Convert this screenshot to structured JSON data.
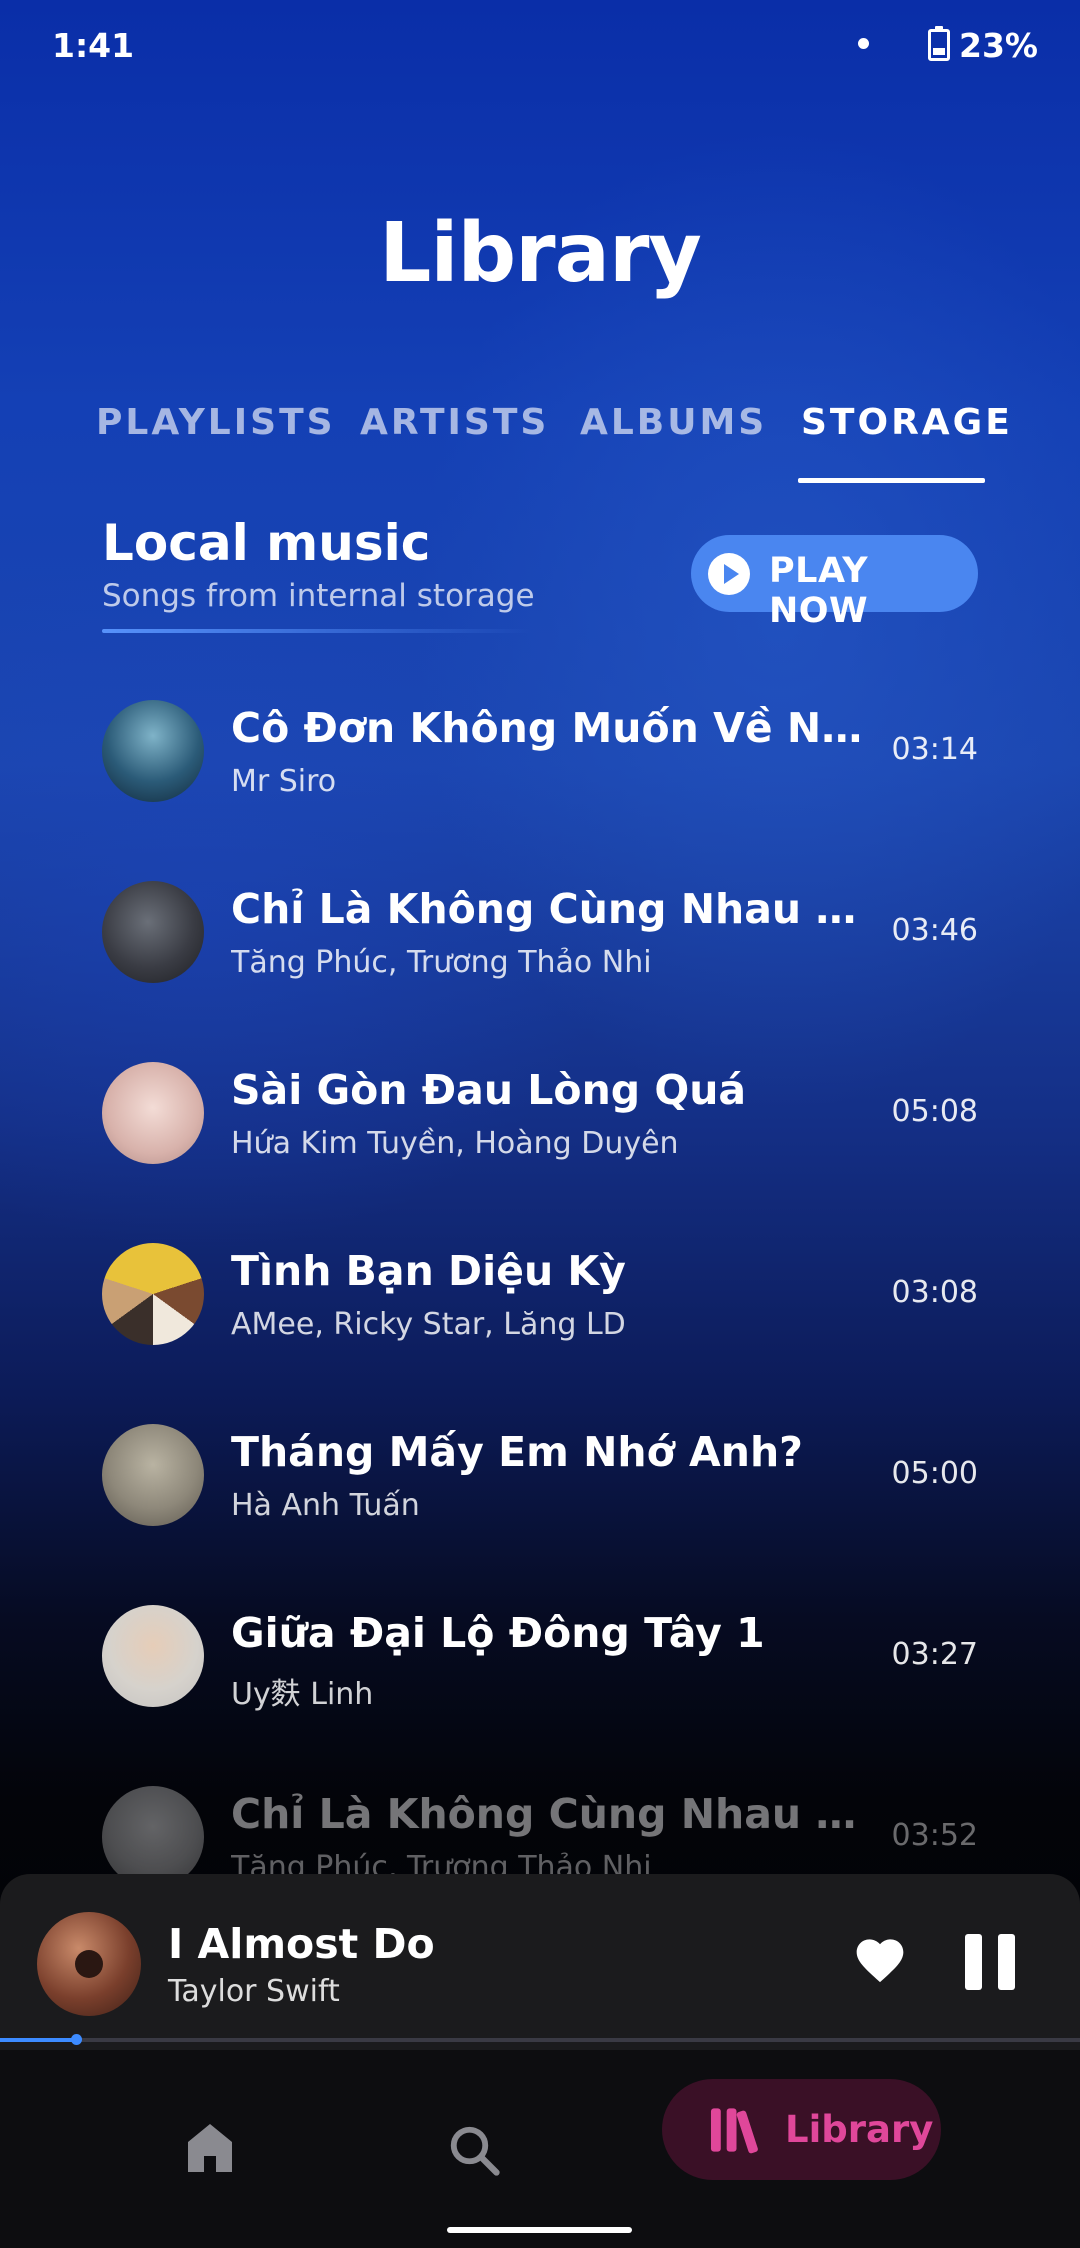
{
  "status_bar": {
    "time": "1:41",
    "battery": "23%"
  },
  "header": {
    "title": "Library"
  },
  "tabs": [
    {
      "label": "PLAYLISTS",
      "active": false
    },
    {
      "label": "ARTISTS",
      "active": false
    },
    {
      "label": "ALBUMS",
      "active": false
    },
    {
      "label": "STORAGE",
      "active": true
    }
  ],
  "section": {
    "title": "Local music",
    "subtitle": "Songs from internal storage",
    "play_label": "PLAY NOW"
  },
  "songs": [
    {
      "title": "Cô Đơn Không Muốn Về Nhà",
      "artist": "Mr Siro",
      "duration": "03:14"
    },
    {
      "title": "Chỉ Là Không Cùng Nhau (Live V...",
      "artist": "Tăng Phúc,  Trương Thảo Nhi",
      "duration": "03:46"
    },
    {
      "title": "Sài Gòn Đau Lòng Quá",
      "artist": "Hứa Kim Tuyền, Hoàng Duyên",
      "duration": "05:08"
    },
    {
      "title": "Tình Bạn Diệu Kỳ",
      "artist": "AMee, Ricky Star, Lăng LD",
      "duration": "03:08"
    },
    {
      "title": "Tháng Mấy Em Nhớ Anh?",
      "artist": "Hà Anh Tuấn",
      "duration": "05:00"
    },
    {
      "title": "Giữa Đại Lộ Đông Tây 1",
      "artist": "Uy麩 Linh",
      "duration": "03:27"
    },
    {
      "title": "Chỉ Là Không Cùng Nhau (Live)",
      "artist": "Tăng Phúc, Trương Thảo Nhi",
      "duration": "03:52"
    }
  ],
  "now_playing": {
    "title": "I Almost Do",
    "artist": "Taylor Swift",
    "progress": 0.07
  },
  "bottom_nav": {
    "items": [
      {
        "icon": "home-icon",
        "label": ""
      },
      {
        "icon": "search-icon",
        "label": ""
      },
      {
        "icon": "library-icon",
        "label": "Library",
        "active": true
      }
    ]
  },
  "colors": {
    "accent_blue": "#4a86f0",
    "progress_blue": "#3d8bff",
    "library_pink": "#e0479a",
    "library_pill_bg": "#3a1026"
  }
}
